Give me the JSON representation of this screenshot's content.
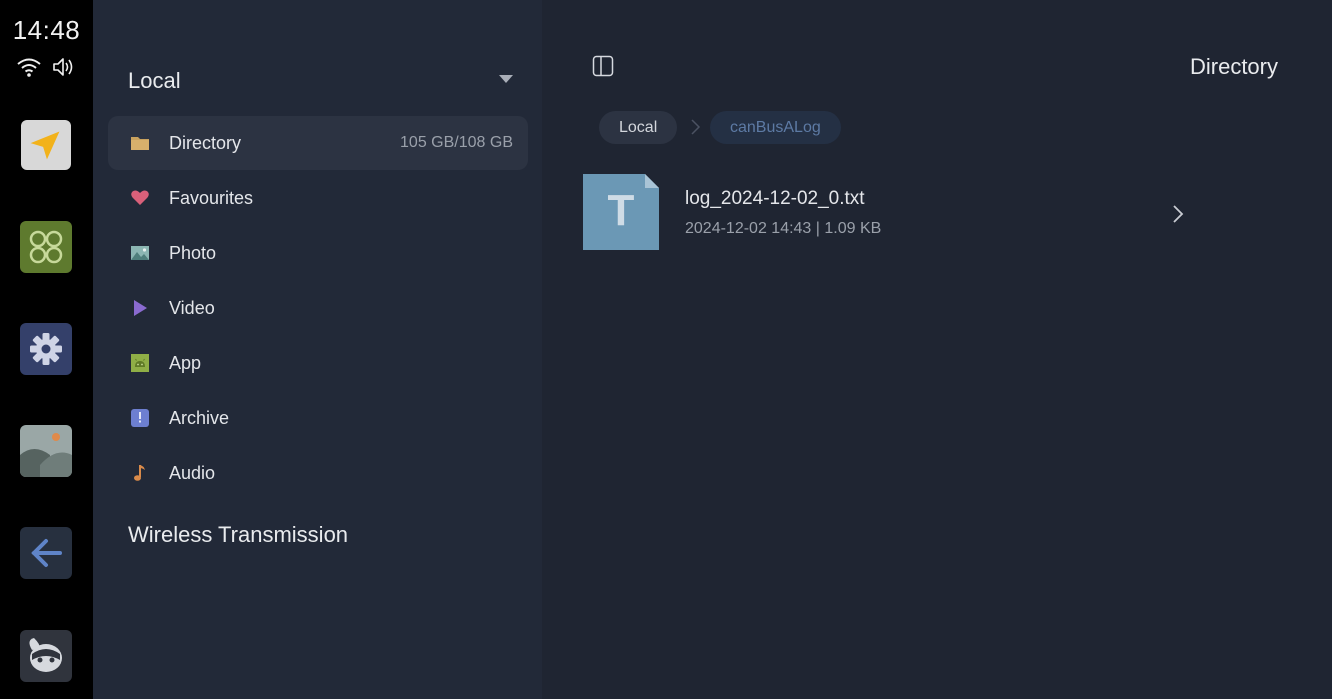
{
  "status_bar": {
    "time": "14:48",
    "wifi_icon": "wifi-icon",
    "volume_icon": "volume-icon"
  },
  "dock": {
    "apps": [
      {
        "name": "navigation-app",
        "icon": "navigation-arrow-icon"
      },
      {
        "name": "apps-grid-app",
        "icon": "four-circles-icon"
      },
      {
        "name": "settings-app",
        "icon": "gear-icon"
      },
      {
        "name": "gallery-app",
        "icon": "landscape-icon"
      },
      {
        "name": "back-app",
        "icon": "arrow-left-icon"
      },
      {
        "name": "assistant-app",
        "icon": "mascot-icon"
      }
    ]
  },
  "sidebar": {
    "local_title": "Local",
    "items": [
      {
        "label": "Directory",
        "usage": "105 GB/108 GB",
        "icon": "folder-icon",
        "color": "#c9a25e",
        "active": true
      },
      {
        "label": "Favourites",
        "icon": "heart-icon",
        "color": "#d9607a"
      },
      {
        "label": "Photo",
        "icon": "image-icon",
        "color": "#6fa3a0"
      },
      {
        "label": "Video",
        "icon": "play-icon",
        "color": "#8a6ad0"
      },
      {
        "label": "App",
        "icon": "android-icon",
        "color": "#8fae46"
      },
      {
        "label": "Archive",
        "icon": "archive-icon",
        "color": "#6d7fd0"
      },
      {
        "label": "Audio",
        "icon": "music-note-icon",
        "color": "#d98a4a"
      }
    ],
    "wireless_title": "Wireless Transmission"
  },
  "main": {
    "title": "Directory",
    "breadcrumb": {
      "root": "Local",
      "current": "canBusALog"
    },
    "files": [
      {
        "name": "log_2024-12-02_0.txt",
        "meta": "2024-12-02 14:43 | 1.09 KB",
        "icon_letter": "T",
        "icon_color": "#6b98b5"
      }
    ]
  },
  "colors": {
    "accent_breadcrumb": "#5d7aa4",
    "sidebar_bg": "#222938",
    "main_bg": "#1f2532",
    "active_item_bg": "#2c3342"
  }
}
